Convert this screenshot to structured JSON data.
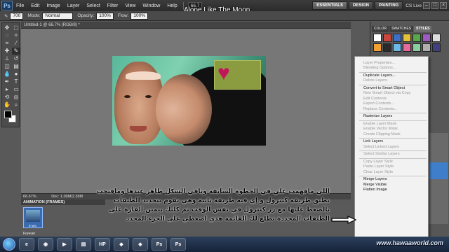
{
  "menubar": {
    "items": [
      "File",
      "Edit",
      "Image",
      "Layer",
      "Select",
      "Filter",
      "View",
      "Window",
      "Help"
    ],
    "zoom": "66.7",
    "workspaces": [
      "ESSENTIALS",
      "DESIGN",
      "PAINTING"
    ],
    "cs_live": "CS Live"
  },
  "title_overlay": "Alone Like The Moon",
  "options": {
    "mode_label": "Mode:",
    "mode_value": "Normal",
    "opacity_label": "Opacity:",
    "opacity_value": "100%",
    "flow_label": "Flow:",
    "flow_value": "100%",
    "brush_size": "700"
  },
  "document": {
    "tab": "Untitled-1 @ 66.7% (RGB/8) *",
    "zoom": "66.67%",
    "doc_info": "Doc: 1.00M/2.38M"
  },
  "animation": {
    "header": "ANIMATION (FRAMES)",
    "frame_label": "0 sec.",
    "loop": "Forever"
  },
  "right_panel": {
    "tabs": [
      "COLOR",
      "SWATCHES",
      "STYLES"
    ],
    "style_colors": [
      "#ffffff",
      "#c9463d",
      "#3f6fc4",
      "#e3c23a",
      "#59a84b",
      "#9d5bc2",
      "#dddddd",
      "#f0a030",
      "#2a2a2a",
      "#6ab7e8",
      "#e86a9a",
      "#88d0a0",
      "#b0b0b0",
      "#404080"
    ]
  },
  "context_menu": {
    "items": [
      {
        "label": "Layer Properties...",
        "disabled": true
      },
      {
        "label": "Blending Options...",
        "disabled": true
      },
      {
        "sep": true
      },
      {
        "label": "Duplicate Layers...",
        "disabled": false
      },
      {
        "label": "Delete Layers",
        "disabled": true
      },
      {
        "sep": true
      },
      {
        "label": "Convert to Smart Object",
        "disabled": false
      },
      {
        "label": "New Smart Object via Copy",
        "disabled": true
      },
      {
        "label": "Edit Contents",
        "disabled": true
      },
      {
        "label": "Export Contents...",
        "disabled": true
      },
      {
        "label": "Replace Contents...",
        "disabled": true
      },
      {
        "sep": true
      },
      {
        "label": "Rasterize Layers",
        "disabled": false
      },
      {
        "sep": true
      },
      {
        "label": "Enable Layer Mask",
        "disabled": true
      },
      {
        "label": "Enable Vector Mask",
        "disabled": true
      },
      {
        "label": "Create Clipping Mask",
        "disabled": true
      },
      {
        "sep": true
      },
      {
        "label": "Link Layers",
        "disabled": false
      },
      {
        "label": "Select Linked Layers",
        "disabled": true
      },
      {
        "sep": true
      },
      {
        "label": "Select Similar Layers",
        "disabled": true
      },
      {
        "sep": true
      },
      {
        "label": "Copy Layer Style",
        "disabled": true
      },
      {
        "label": "Paste Layer Style",
        "disabled": true
      },
      {
        "label": "Clear Layer Style",
        "disabled": true
      },
      {
        "sep": true
      },
      {
        "label": "Merge Layers",
        "disabled": false
      },
      {
        "label": "Merge Visible",
        "disabled": false
      },
      {
        "label": "Flatten Image",
        "disabled": false
      }
    ]
  },
  "arabic_lines": [
    "اللي مافهمت علي في الخطوة السابقة وباقي الشكل ظاهر عندها ومافتحت",
    "تطبق طريقة كنترول و إي فيه طريقة ثانية وهي نقوم بتحديد الطبقات",
    "بالضغط عليها مع زر كنترول في نفس الوقت ثم كليك بيمين الفارة على",
    "الطبقات المحددة تطلع لك القائمة هذي اضغطي على الجزء المحدد"
  ],
  "taskbar": {
    "buttons": [
      "e",
      "◉",
      "▶",
      "▤",
      "HP",
      "◆",
      "◈",
      "Ps",
      "Ps"
    ]
  },
  "watermark": "www.hawaaworld.com"
}
